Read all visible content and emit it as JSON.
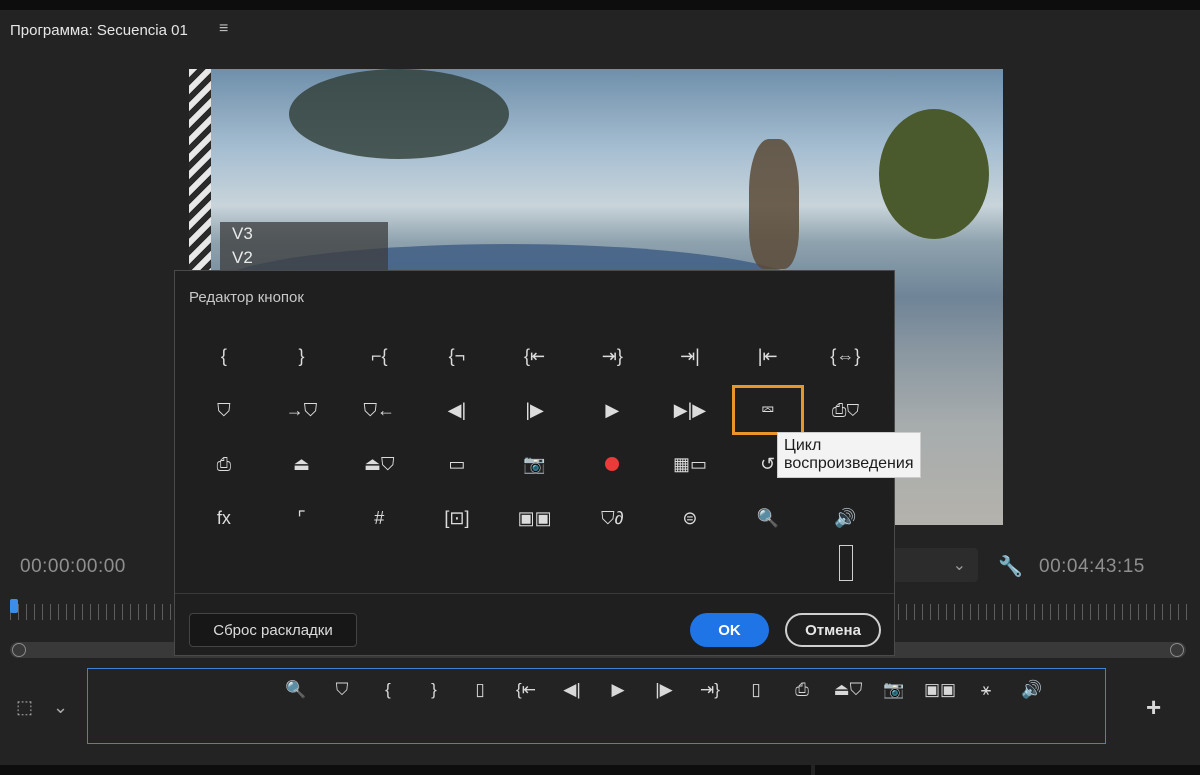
{
  "panel": {
    "title": "Программа: Secuencia 01",
    "menu_icon": "hamburger-menu-icon"
  },
  "video": {
    "tracks": [
      "V3",
      "V2"
    ]
  },
  "timecode": {
    "current": "00:00:00:00",
    "duration": "00:04:43:15"
  },
  "dialog": {
    "title": "Редактор кнопок",
    "tooltip": "Цикл воспроизведения",
    "grid": [
      [
        "{",
        "}",
        "⌐{",
        "{¬",
        "{⇤",
        "⇥}",
        "⇥|",
        "|⇤",
        "{⇔}"
      ],
      [
        "⛉",
        "→⛉",
        "⛉←",
        "◀|",
        "|▶",
        "▶",
        "▶|▶",
        "loop",
        "⎙⛉"
      ],
      [
        "⎙",
        "⏏",
        "⏏⛉",
        "▭",
        "📷",
        "rec",
        "▦▭",
        "↺",
        "≋"
      ],
      [
        "fx",
        "⌜",
        "#",
        "[⊡]",
        "▣▣",
        "⛉∂",
        "⊜",
        "🔍",
        "🔊"
      ]
    ],
    "buttons": {
      "reset": "Сброс раскладки",
      "ok": "OK",
      "cancel": "Отмена"
    }
  },
  "toolbar": {
    "icons": [
      "🔍",
      "⛉",
      "{",
      "}",
      "▯",
      "{⇤",
      "◀|",
      "▶",
      "|▶",
      "⇥}",
      "▯",
      "⎙",
      "⏏⛉",
      "📷",
      "▣▣",
      "⚹",
      "🔊"
    ]
  },
  "icons": {
    "wrench": "🔧",
    "chevron": "⌄",
    "transform": "⬚",
    "plus": "+"
  }
}
